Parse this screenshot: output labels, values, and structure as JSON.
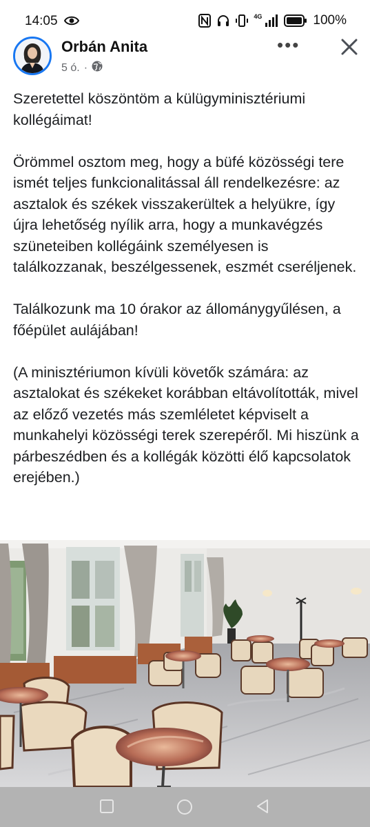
{
  "status_bar": {
    "time": "14:05",
    "network": "4G",
    "battery": "100%"
  },
  "post": {
    "author": "Orbán Anita",
    "time": "5 ó.",
    "paragraphs": [
      "Szeretettel köszöntöm a külügyminisztériumi kollégáimat!",
      "Örömmel osztom meg, hogy a büfé közösségi tere ismét teljes funkcionalitással áll rendelkezésre: az asztalok és székek visszakerültek a helyükre, így újra lehetőség nyílik arra, hogy a munkavégzés szüneteiben kollégáink személyesen is találkozzanak, beszélgessenek, eszmét cseréljenek.",
      "Találkozunk ma 10 órakor az állománygyűlésen, a főépület aulájában!",
      "(A minisztériumon kívüli követők számára: az asztalokat és székeket korábban eltávolították, mivel az előző vezetés más szemléletet képviselt a munkahelyi közösségi terek szerepéről. Mi hiszünk a párbeszédben és a kollégák közötti élő kapcsolatok erejében.)"
    ]
  },
  "icons": {
    "eye": "eye-icon",
    "nfc": "nfc-icon",
    "headphones": "headphones-icon",
    "vibrate": "vibrate-icon",
    "signal": "signal-icon",
    "battery": "battery-icon",
    "globe": "globe-icon",
    "more": "more-icon",
    "close": "close-icon"
  },
  "colors": {
    "accent": "#1877f2",
    "nav_bar": "#b3b3b3"
  }
}
